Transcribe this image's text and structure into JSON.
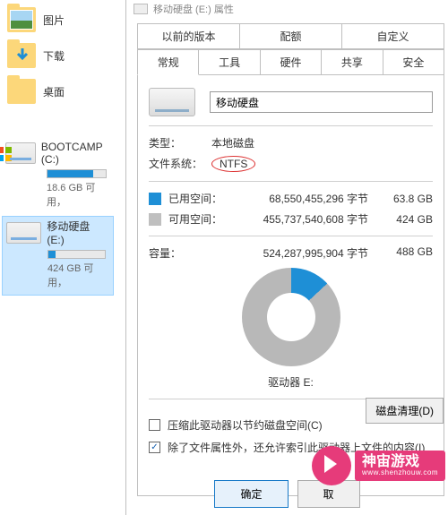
{
  "sidebar": {
    "items": [
      {
        "label": "图片"
      },
      {
        "label": "下载"
      },
      {
        "label": "桌面"
      }
    ],
    "drives": [
      {
        "name": "BOOTCAMP (C:)",
        "sub": "18.6 GB 可用，",
        "fill": 78
      },
      {
        "name": "移动硬盘 (E:)",
        "sub": "424 GB 可用，",
        "fill": 13
      }
    ]
  },
  "panel": {
    "window_title": "移动硬盘 (E:) 属性",
    "tabs_top": [
      "以前的版本",
      "配额",
      "自定义"
    ],
    "tabs_bottom": [
      "常规",
      "工具",
      "硬件",
      "共享",
      "安全"
    ],
    "drive_name_value": "移动硬盘",
    "type_label": "类型：",
    "type_value": "本地磁盘",
    "fs_label": "文件系统：",
    "fs_value": "NTFS",
    "used_label": "已用空间：",
    "used_bytes": "68,550,455,296 字节",
    "used_hr": "63.8 GB",
    "free_label": "可用空间：",
    "free_bytes": "455,737,540,608 字节",
    "free_hr": "424 GB",
    "cap_label": "容量：",
    "cap_bytes": "524,287,995,904 字节",
    "cap_hr": "488 GB",
    "drive_letter": "驱动器 E:",
    "cleanup": "磁盘清理(D)",
    "check1": "压缩此驱动器以节约磁盘空间(C)",
    "check2": "除了文件属性外，还允许索引此驱动器上文件的内容(I)",
    "ok": "确定",
    "cancel": "取"
  },
  "watermark": {
    "brand": "神宙游戏",
    "url": "www.shenzhouw.com"
  },
  "chart_data": {
    "type": "pie",
    "title": "驱动器 E:",
    "series": [
      {
        "name": "已用空间",
        "value": 68550455296,
        "human": "63.8 GB",
        "color": "#1e8fd6"
      },
      {
        "name": "可用空间",
        "value": 455737540608,
        "human": "424 GB",
        "color": "#b8b8b8"
      }
    ],
    "total": {
      "value": 524287995904,
      "human": "488 GB"
    }
  }
}
